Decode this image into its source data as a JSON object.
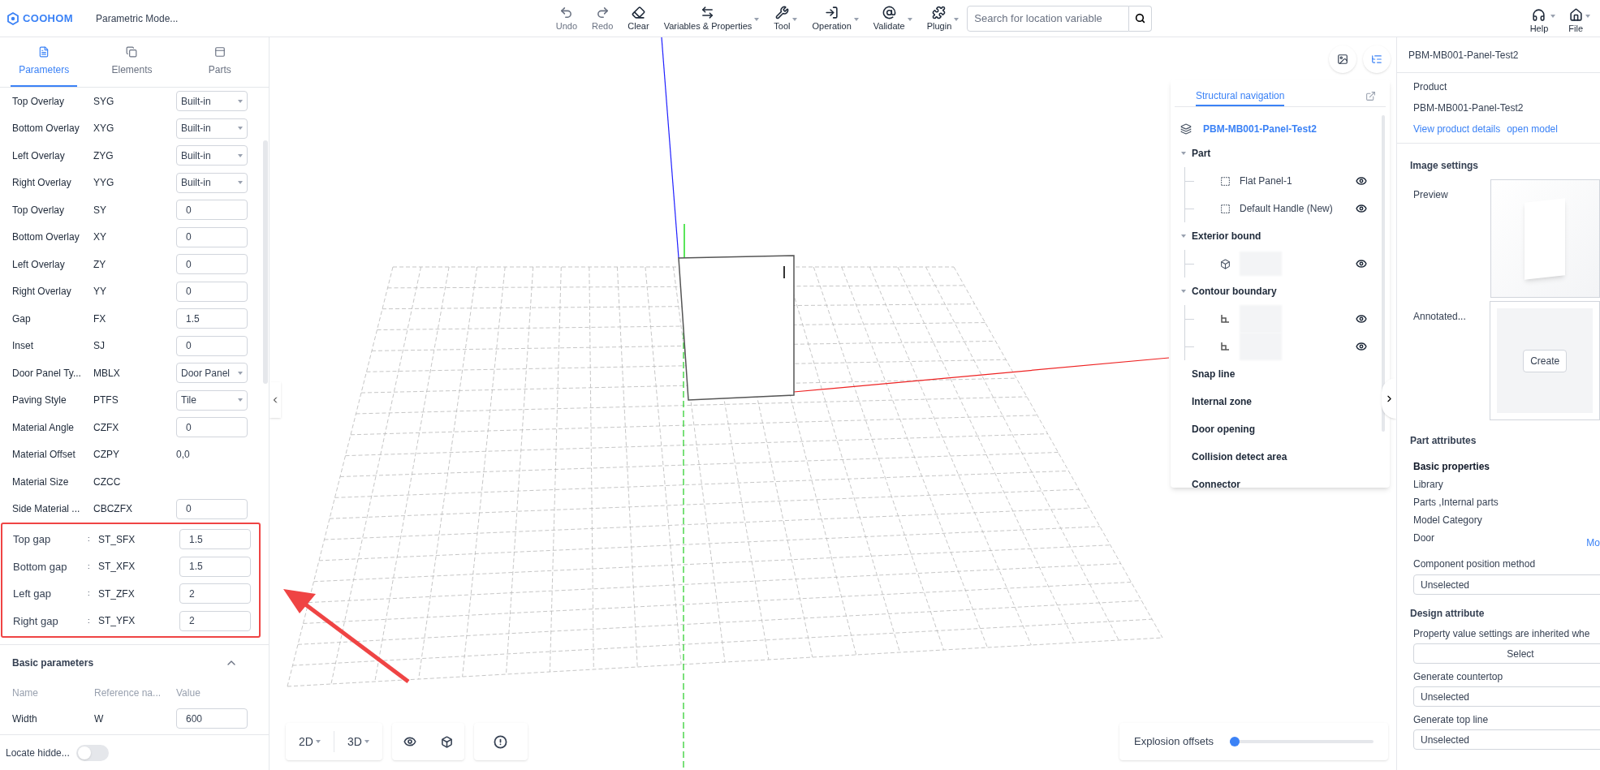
{
  "app": {
    "logo": "COOHOM",
    "title": "Parametric Mode..."
  },
  "toolbar": [
    {
      "kind": "undo",
      "label": "Undo",
      "disabled": true,
      "has_menu": false
    },
    {
      "kind": "redo",
      "label": "Redo",
      "disabled": true,
      "has_menu": false
    },
    {
      "kind": "clear",
      "label": "Clear",
      "disabled": false,
      "has_menu": false
    },
    {
      "kind": "variables",
      "label": "Variables & Properties",
      "disabled": false,
      "has_menu": true
    },
    {
      "kind": "tool",
      "label": "Tool",
      "disabled": false,
      "has_menu": true
    },
    {
      "kind": "operation",
      "label": "Operation",
      "disabled": false,
      "has_menu": true
    },
    {
      "kind": "validate",
      "label": "Validate",
      "disabled": false,
      "has_menu": true
    },
    {
      "kind": "plugin",
      "label": "Plugin",
      "disabled": false,
      "has_menu": true
    }
  ],
  "search": {
    "placeholder": "Search for location variable"
  },
  "top_right": [
    {
      "kind": "help",
      "label": "Help"
    },
    {
      "kind": "file",
      "label": "File"
    }
  ],
  "left_tabs": [
    {
      "kind": "parameters",
      "label": "Parameters",
      "selected": true
    },
    {
      "kind": "elements",
      "label": "Elements",
      "selected": false
    },
    {
      "kind": "parts",
      "label": "Parts",
      "selected": false
    }
  ],
  "parameters": [
    {
      "name": "Top Overlay",
      "ref": "SYG",
      "kind": "select",
      "value": "Built-in"
    },
    {
      "name": "Bottom Overlay",
      "ref": "XYG",
      "kind": "select",
      "value": "Built-in"
    },
    {
      "name": "Left Overlay",
      "ref": "ZYG",
      "kind": "select",
      "value": "Built-in"
    },
    {
      "name": "Right Overlay",
      "ref": "YYG",
      "kind": "select",
      "value": "Built-in"
    },
    {
      "name": "Top Overlay",
      "ref": "SY",
      "kind": "input",
      "value": "0"
    },
    {
      "name": "Bottom Overlay",
      "ref": "XY",
      "kind": "input",
      "value": "0"
    },
    {
      "name": "Left Overlay",
      "ref": "ZY",
      "kind": "input",
      "value": "0"
    },
    {
      "name": "Right Overlay",
      "ref": "YY",
      "kind": "input",
      "value": "0"
    },
    {
      "name": "Gap",
      "ref": "FX",
      "kind": "input",
      "value": "1.5"
    },
    {
      "name": "Inset",
      "ref": "SJ",
      "kind": "input",
      "value": "0"
    },
    {
      "name": "Door Panel Ty...",
      "ref": "MBLX",
      "kind": "select",
      "value": "Door Panel"
    },
    {
      "name": "Paving Style",
      "ref": "PTFS",
      "kind": "select",
      "value": "Tile"
    },
    {
      "name": "Material Angle",
      "ref": "CZFX",
      "kind": "input",
      "value": "0"
    },
    {
      "name": "Material Offset",
      "ref": "CZPY",
      "kind": "text",
      "value": "0,0"
    },
    {
      "name": "Material Size",
      "ref": "CZCC",
      "kind": "empty"
    },
    {
      "name": "Side Material ...",
      "ref": "CBCZFX",
      "kind": "input",
      "value": "0"
    }
  ],
  "highlighted_parameters": [
    {
      "name": "Top gap",
      "separator": ":",
      "ref": "ST_SFX",
      "value": "1.5"
    },
    {
      "name": "Bottom gap",
      "separator": ":",
      "ref": "ST_XFX",
      "value": "1.5"
    },
    {
      "name": "Left gap",
      "separator": ":",
      "ref": "ST_ZFX",
      "value": "2"
    },
    {
      "name": "Right gap",
      "separator": ":",
      "ref": "ST_YFX",
      "value": "2"
    }
  ],
  "basic_parameters": {
    "title": "Basic parameters",
    "expanded": true,
    "columns": [
      "Name",
      "Reference na...",
      "Value"
    ],
    "rows": [
      {
        "name": "Width",
        "ref": "W",
        "value": "600"
      }
    ]
  },
  "locate_hidden": {
    "label": "Locate hidde...",
    "on": false
  },
  "canvas_buttons": [
    {
      "kind": "snapshot",
      "selected": false
    },
    {
      "kind": "tree",
      "selected": true
    }
  ],
  "structural_navigation": {
    "tab": "Structural navigation",
    "root": "PBM-MB001-Panel-Test2",
    "groups": [
      {
        "label": "Part",
        "expanded": true,
        "children": [
          {
            "kind": "part",
            "label": "Flat Panel-1"
          },
          {
            "kind": "part",
            "label": "Default Handle (New)"
          }
        ]
      },
      {
        "label": "Exterior bound",
        "expanded": true,
        "children": [
          {
            "kind": "bound"
          }
        ]
      },
      {
        "label": "Contour boundary",
        "expanded": true,
        "children": [
          {
            "kind": "contour"
          },
          {
            "kind": "contour"
          }
        ]
      },
      {
        "label": "Snap line"
      },
      {
        "label": "Internal zone"
      },
      {
        "label": "Door opening"
      },
      {
        "label": "Collision detect area"
      },
      {
        "label": "Connector"
      }
    ]
  },
  "view_controls": [
    {
      "label": "2D"
    },
    {
      "label": "3D"
    }
  ],
  "explosion": {
    "label": "Explosion offsets",
    "level": 0.02
  },
  "right_panel": {
    "title": "PBM-MB001-Panel-Test2",
    "product_label": "Product",
    "product_name": "PBM-MB001-Panel-Test2",
    "links": [
      "View product details",
      "open model"
    ],
    "image_settings": {
      "title": "Image settings",
      "preview_label": "Preview",
      "annotated_label": "Annotated...",
      "create_button": "Create"
    },
    "part_attributes": {
      "title": "Part attributes",
      "subtitle": "Basic properties",
      "fields": [
        {
          "label": "Library",
          "value": "Parts ,Internal parts"
        },
        {
          "label": "Model Category",
          "value": "Door",
          "link": "Mo"
        }
      ],
      "selects": [
        {
          "label": "Component position method",
          "value": "Unselected"
        }
      ]
    },
    "design_attribute": {
      "title": "Design attribute",
      "fields": [
        {
          "label": "Property value settings are inherited whe",
          "kind": "button",
          "value": "Select"
        },
        {
          "label": "Generate countertop",
          "kind": "select",
          "value": "Unselected"
        },
        {
          "label": "Generate top line",
          "kind": "select",
          "value": "Unselected"
        }
      ]
    }
  }
}
